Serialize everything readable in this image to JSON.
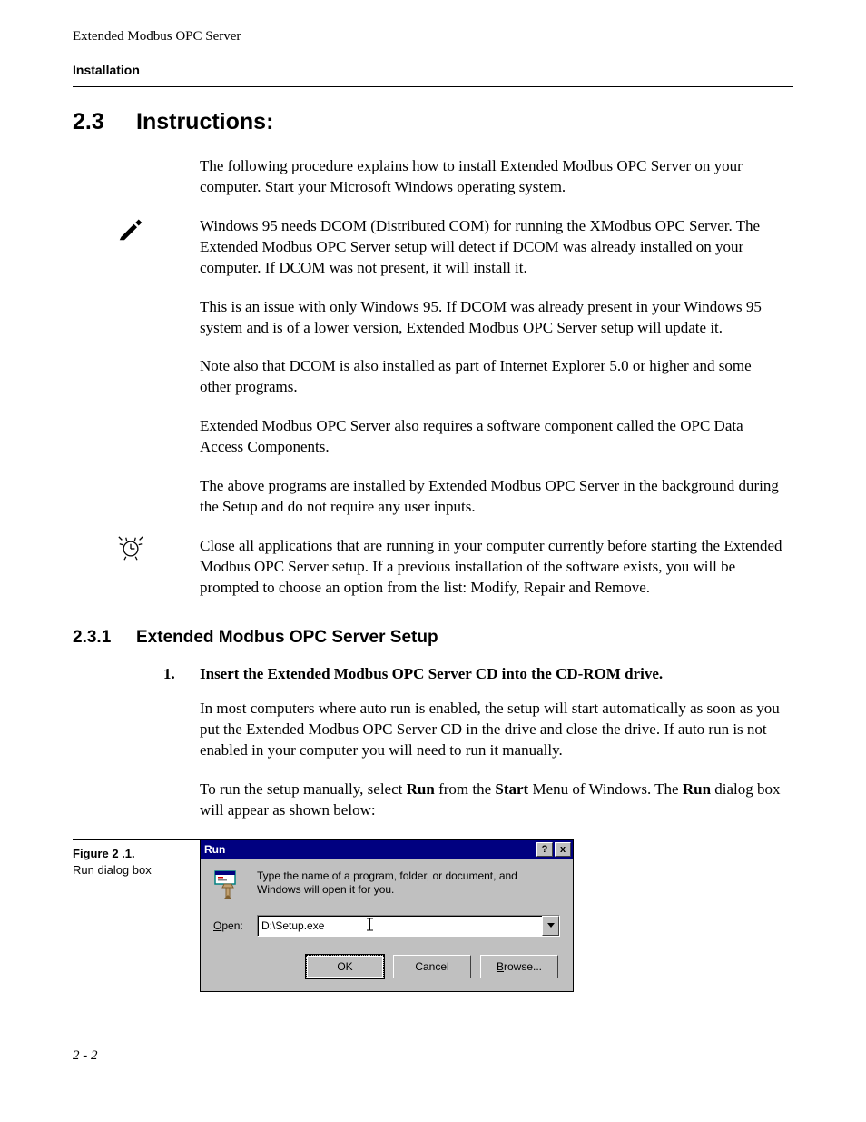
{
  "header": {
    "doc_title": "Extended Modbus OPC Server",
    "section": "Installation"
  },
  "h2": {
    "num": "2.3",
    "title": "Instructions:"
  },
  "intro": "The following procedure explains how to install Extended Modbus OPC Server on your computer. Start your Microsoft Windows operating system.",
  "note1": {
    "p1": "Windows 95 needs DCOM (Distributed COM) for running the XModbus OPC Server. The Extended Modbus OPC Server setup will detect if DCOM was already installed on your computer. If DCOM was not present, it will install it.",
    "p2": "This is an issue with only Windows 95. If DCOM was already present in your Windows 95 system and is of a lower version, Extended Modbus OPC Server setup will update it.",
    "p3": "Note also that DCOM is also installed as part of Internet Explorer 5.0 or higher and some other programs.",
    "p4": "Extended Modbus OPC Server also requires a software component called the OPC Data Access Components.",
    "p5": "The above programs are installed by Extended Modbus OPC Server in the background during the Setup and do not require any user inputs."
  },
  "note2": {
    "p1": "Close all applications that are running in your computer currently before starting the Extended Modbus OPC Server setup. If a previous installation of the software exists, you will be prompted to choose an option from the list: Modify, Repair and Remove."
  },
  "h3": {
    "num": "2.3.1",
    "title": "Extended Modbus OPC Server Setup"
  },
  "step1": {
    "num": "1.",
    "title": "Insert the Extended Modbus OPC Server CD into the CD-ROM drive.",
    "p1": "In most computers where auto run is enabled, the setup will start automatically as soon as you put the Extended Modbus OPC Server CD in the drive and close the drive. If auto run is not enabled in your computer you will need to run it manually.",
    "p2_pre": "To run the setup manually, select ",
    "p2_b1": "Run",
    "p2_mid1": " from the ",
    "p2_b2": "Start",
    "p2_mid2": " Menu of Windows. The ",
    "p2_b3": "Run",
    "p2_post": " dialog box will appear as shown below:"
  },
  "figure": {
    "label": "Figure 2 .1.",
    "caption": "Run dialog box"
  },
  "dialog": {
    "title": "Run",
    "help": "?",
    "close": "x",
    "instruction": "Type the name of a program, folder, or document, and Windows will open it for you.",
    "open_under": "O",
    "open_rest": "pen:",
    "input_value": "D:\\Setup.exe",
    "ok": "OK",
    "cancel": "Cancel",
    "browse_under": "B",
    "browse_rest": "rowse..."
  },
  "footer": "2 - 2"
}
